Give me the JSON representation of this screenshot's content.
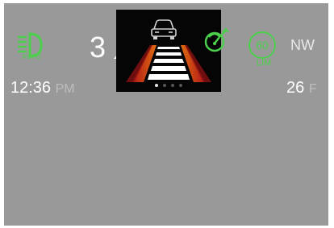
{
  "status_bar": {
    "headlight_mode": "AUTO",
    "gear": "3",
    "speed_limit": {
      "value": "60",
      "label": "LIM"
    },
    "heading": "NW",
    "clock": {
      "time": "12:36",
      "ampm": "PM"
    },
    "temperature": {
      "value": "26",
      "unit": "F"
    }
  },
  "adas_panel": {
    "pager": {
      "total": 4,
      "active_index": 0
    }
  },
  "icons": {
    "headlight": "auto-headlight-icon",
    "gear_arrow": "gear-arrow-icon",
    "car": "car-icon",
    "driver_assist": "driver-assist-icon"
  },
  "colors": {
    "indicator_green": "#4cd04c",
    "lane_orange": "#e06a10",
    "lane_red": "#b01818",
    "background": "#999999"
  }
}
